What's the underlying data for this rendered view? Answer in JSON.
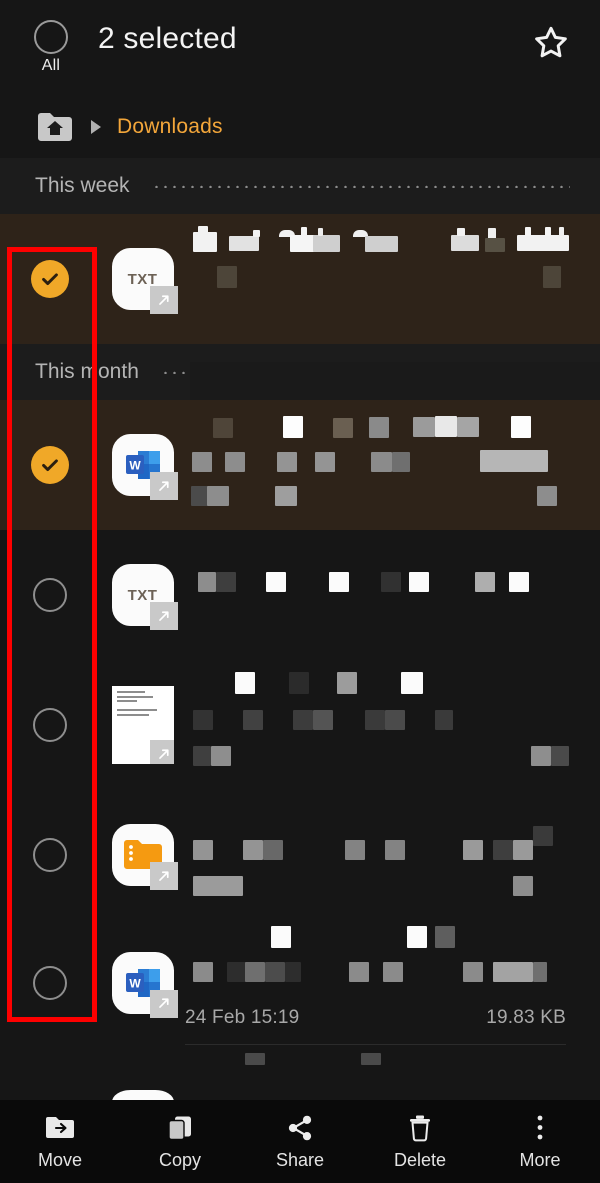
{
  "appbar": {
    "select_all_label": "All",
    "title": "2 selected",
    "favorite_icon": "star-icon"
  },
  "breadcrumb": {
    "home_icon": "home-folder-icon",
    "separator_icon": "triangle-right-icon",
    "current": "Downloads"
  },
  "sections": [
    {
      "label": "This week"
    },
    {
      "label": "This month"
    }
  ],
  "rows": [
    {
      "id": "row-1",
      "selected": true,
      "checkbox_state": "checked",
      "icon": "txt-file-icon",
      "icon_label": "TXT",
      "name_redacted": true,
      "date": "",
      "size": ""
    },
    {
      "id": "row-2",
      "selected": true,
      "checkbox_state": "checked",
      "icon": "word-document-icon",
      "icon_label": "W",
      "name_redacted": true,
      "date": "",
      "size": ""
    },
    {
      "id": "row-3",
      "selected": false,
      "checkbox_state": "unchecked",
      "icon": "txt-file-icon",
      "icon_label": "TXT",
      "name_redacted": true,
      "date": "",
      "size": ""
    },
    {
      "id": "row-4",
      "selected": false,
      "checkbox_state": "unchecked",
      "icon": "document-thumbnail-icon",
      "icon_label": "",
      "name_redacted": true,
      "date": "",
      "size": ""
    },
    {
      "id": "row-5",
      "selected": false,
      "checkbox_state": "unchecked",
      "icon": "folder-archive-icon",
      "icon_label": "",
      "name_redacted": true,
      "date": "",
      "size": ""
    },
    {
      "id": "row-6",
      "selected": false,
      "checkbox_state": "unchecked",
      "icon": "word-document-icon",
      "icon_label": "W",
      "name_redacted": true,
      "date": "24 Feb 15:19",
      "size": "19.83 KB"
    }
  ],
  "toolbar": {
    "items": [
      {
        "label": "Move",
        "icon": "move-to-folder-icon"
      },
      {
        "label": "Copy",
        "icon": "copy-icon"
      },
      {
        "label": "Share",
        "icon": "share-icon"
      },
      {
        "label": "Delete",
        "icon": "trash-icon"
      },
      {
        "label": "More",
        "icon": "more-vertical-icon"
      }
    ]
  },
  "annotation": {
    "shape": "rectangle",
    "color": "#fe0000",
    "target": "checkbox-column"
  },
  "colors": {
    "background": "#161616",
    "section_background": "#1c1c1c",
    "selected_row": "#2e2319",
    "accent_orange": "#f0a828",
    "breadcrumb_orange": "#f3a63a",
    "annotation_red": "#fe0000",
    "bottombar": "#0a0a0a"
  }
}
